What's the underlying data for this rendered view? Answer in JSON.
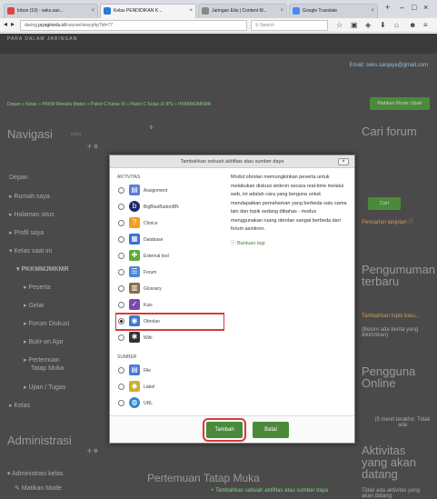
{
  "browser": {
    "tabs": [
      {
        "title": "Inbox (10) - seks.san...",
        "icon_color": "#d44"
      },
      {
        "title": "Kelas PENDIDIKAN K...",
        "icon_color": "#2a7ad6"
      },
      {
        "title": "Jaringan Edu | Content M...",
        "icon_color": "#888"
      },
      {
        "title": "Google Translate",
        "icon_color": "#4a8af4"
      }
    ],
    "url_prefix": "daring.",
    "url_domain": "jayagiriedu.id",
    "url_path": "/course/view.php?id=77",
    "search_placeholder": "Search",
    "window_controls": [
      "–",
      "□",
      "×"
    ]
  },
  "page": {
    "site_tag": "PARA DALAM JARINGAN",
    "email": "Email: seks.sanjaya@gmail.com",
    "breadcrumb": "Depan » Kelas » PKKM Menulis Materi » Paket C Kelas XI » Paket C Kelas XI IPS » PKKMMJMKMR",
    "edit_button": "Matikan Mode Ubah",
    "navigation": {
      "title": "Navigasi",
      "items": [
        "Depan",
        "▸ Rumah saya",
        "▸ Halaman situs",
        "▸ Profil saya",
        "▾ Kelas saat ini",
        "▾ PKKMMJMKMR",
        "▸ Peserta",
        "▸ Gelar",
        "▸ Forum Diskusi",
        "▸ Butir-an Ajar",
        "▸ Pertemuan",
        "Tatap Muka",
        "▸ Ujian / Tugas",
        "▸ Kelas"
      ]
    },
    "admin": {
      "title": "Administrasi",
      "item": "▾ Administrasi kelas",
      "sub": "✎ Matikan Mode"
    },
    "forum": {
      "title": "Cari forum",
      "button": "Cari",
      "link": "Pencarian lanjutan ⓘ"
    },
    "news": {
      "title": "Pengumuman terbaru",
      "link": "Tambahkan topik baru...",
      "text": "(Belum ada berita yang dikirimkan)"
    },
    "online": {
      "title": "Pengguna Online",
      "text": "(5 menit terakhir: Tidak ada"
    },
    "activities": {
      "title": "Aktivitas yang akan datang",
      "text": "Tidak ada aktivitas yang akan datang"
    },
    "add_activity_link": "+ Tambahkan sebuah aktifitas atau sumber daya",
    "section_title": "Pertemuan Tatap Muka"
  },
  "modal": {
    "title": "Tambahkan sebuah aktifitas atau sumber daya",
    "close": "×",
    "activities_header": "AKTIVITAS",
    "resources_header": "SUMBER",
    "activities": [
      {
        "label": "Assignment",
        "icon": "assignment-icon",
        "color": "#5a7bd6",
        "glyph": "▤",
        "selected": false
      },
      {
        "label": "BigBlueButtonBN",
        "icon": "bigbluebutton-icon",
        "color": "#1b2a6b",
        "glyph": "b",
        "selected": false
      },
      {
        "label": "Choice",
        "icon": "choice-icon",
        "color": "#f0a020",
        "glyph": "?",
        "selected": false
      },
      {
        "label": "Database",
        "icon": "database-icon",
        "color": "#3a6fd0",
        "glyph": "▦",
        "selected": false
      },
      {
        "label": "External tool",
        "icon": "puzzle-icon",
        "color": "#5cae3a",
        "glyph": "✚",
        "selected": false
      },
      {
        "label": "Forum",
        "icon": "forum-icon",
        "color": "#4a88d8",
        "glyph": "☰",
        "selected": false
      },
      {
        "label": "Glossary",
        "icon": "glossary-icon",
        "color": "#8a6a4a",
        "glyph": "▥",
        "selected": false
      },
      {
        "label": "Kuis",
        "icon": "quiz-icon",
        "color": "#7a4ab0",
        "glyph": "✓",
        "selected": false
      },
      {
        "label": "Obrolan",
        "icon": "chat-icon",
        "color": "#3a7ad0",
        "glyph": "◉",
        "selected": true
      },
      {
        "label": "Wiki",
        "icon": "wiki-icon",
        "color": "#333333",
        "glyph": "✱",
        "selected": false
      }
    ],
    "resources": [
      {
        "label": "File",
        "icon": "file-icon",
        "color": "#4a7ad0",
        "glyph": "▤"
      },
      {
        "label": "Label",
        "icon": "label-icon",
        "color": "#d0b030",
        "glyph": "◆"
      },
      {
        "label": "URL",
        "icon": "url-icon",
        "color": "#2a8ad0",
        "glyph": "◍"
      }
    ],
    "description": "Modul obrolan memungkinkan peserta untuk melakukan diskusi sinkron secara real-time melalui web, ini adalah cara yang berguna untuk mendapatkan pemahaman yang berbeda satu sama lain dan topik sedang dibahas - modus menggunakan ruang obrolan sangat berbeda dari forum asinkron.",
    "more_help": "ⓘ Bantuan lagi",
    "add_button": "Tambah",
    "cancel_button": "Batal"
  }
}
